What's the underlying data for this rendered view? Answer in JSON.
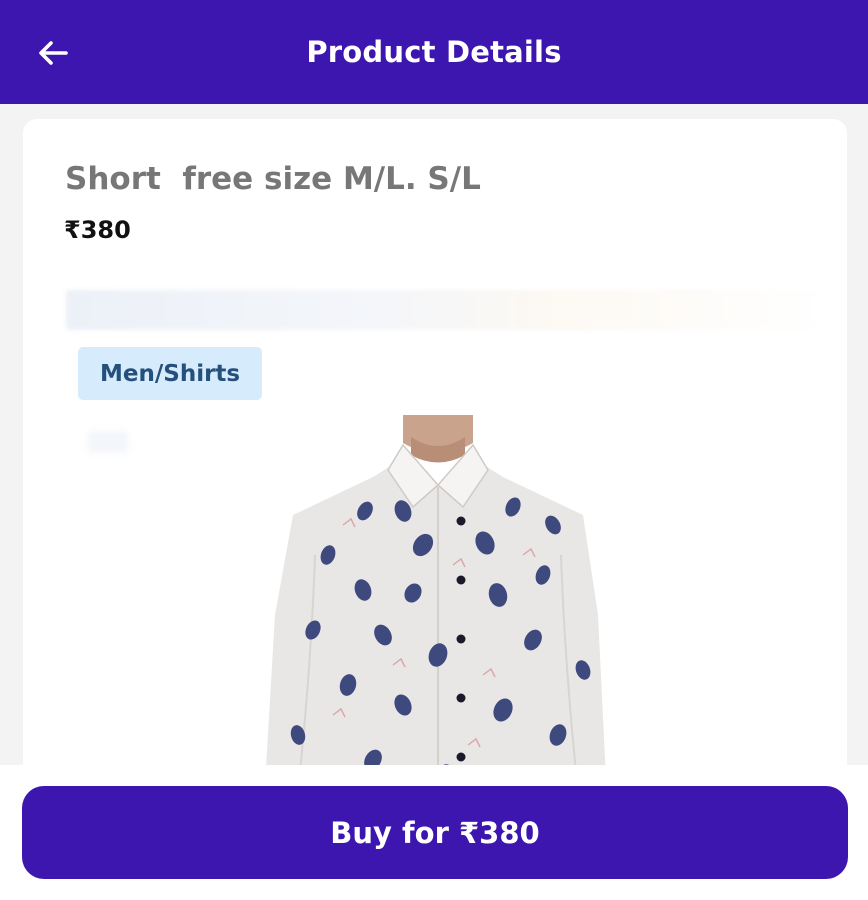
{
  "header": {
    "title": "Product Details",
    "back_icon": "arrow-left-icon"
  },
  "product": {
    "title": "Short  free size M/L. S/L",
    "price": "₹380",
    "category": "Men/Shirts",
    "image_icon": "shirt-photo"
  },
  "footer": {
    "buy_label": "Buy for ₹380"
  },
  "colors": {
    "primary": "#3d16b0",
    "chip_bg": "#d6ebfb",
    "chip_text": "#254f7c"
  }
}
